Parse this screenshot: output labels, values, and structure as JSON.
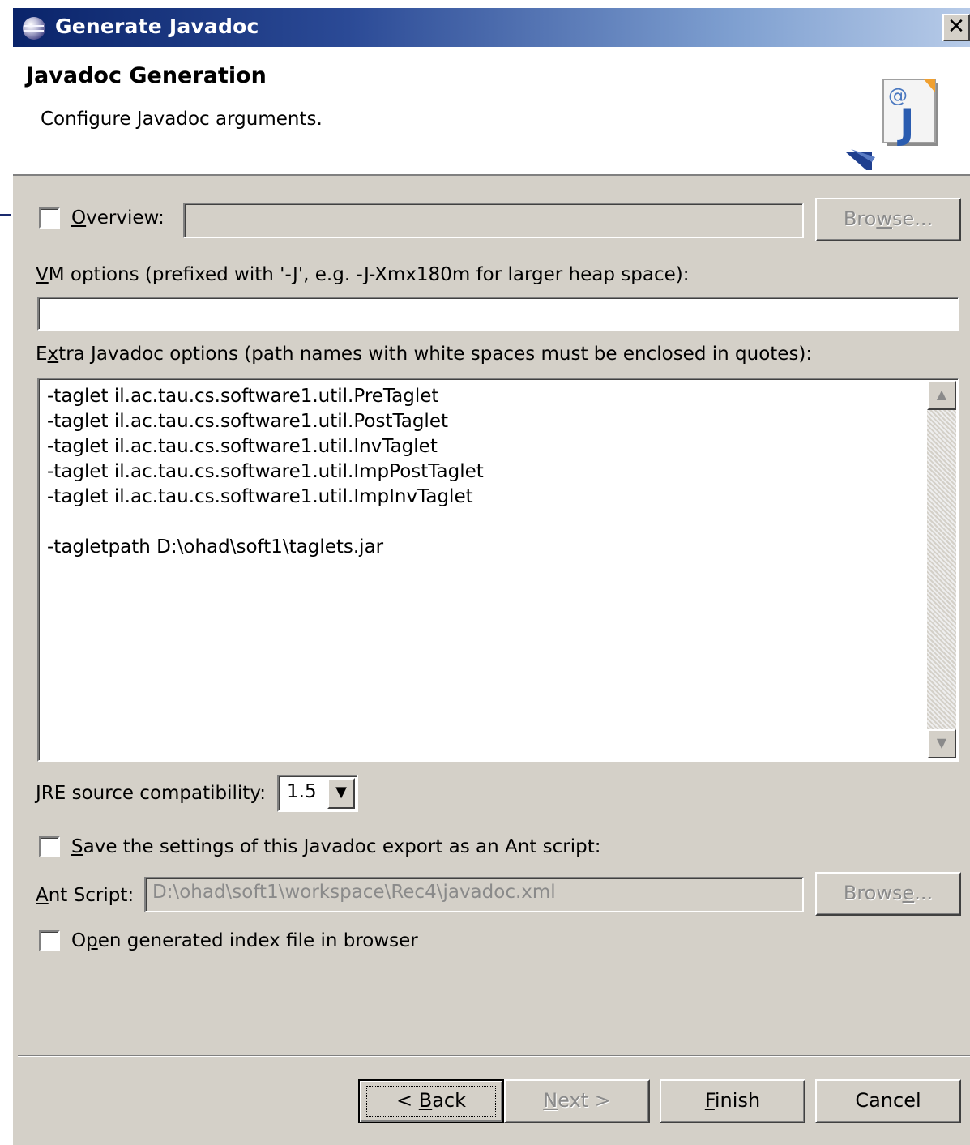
{
  "window": {
    "title": "Generate Javadoc",
    "close_glyph": "✕"
  },
  "header": {
    "title": "Javadoc Generation",
    "description": "Configure Javadoc arguments.",
    "icon": "javadoc-wizard-icon"
  },
  "overview": {
    "mnemonic": "O",
    "label_rest": "verview:",
    "checked": false,
    "value": "",
    "browse_pre": "Bro",
    "browse_mn": "w",
    "browse_post": "se..."
  },
  "vm_options": {
    "label_mn": "V",
    "label_rest": "M options (prefixed with '-J', e.g. -J-Xmx180m for larger heap space):",
    "value": ""
  },
  "extra_options": {
    "label_pre": "E",
    "label_mn": "x",
    "label_post": "tra Javadoc options (path names with white spaces must be enclosed in quotes):",
    "lines": [
      "-taglet il.ac.tau.cs.software1.util.PreTaglet",
      "-taglet il.ac.tau.cs.software1.util.PostTaglet",
      "-taglet il.ac.tau.cs.software1.util.InvTaglet",
      "-taglet il.ac.tau.cs.software1.util.ImpPostTaglet",
      "-taglet il.ac.tau.cs.software1.util.ImpInvTaglet",
      "",
      "-tagletpath D:\\ohad\\soft1\\taglets.jar"
    ],
    "scroll_up_glyph": "▲",
    "scroll_down_glyph": "▼"
  },
  "jre": {
    "label_mn": "J",
    "label_rest": "RE source compatibility:",
    "value": "1.5",
    "arrow_glyph": "▼"
  },
  "save_ant": {
    "mnemonic": "S",
    "label_rest": "ave the settings of this Javadoc export as an Ant script:",
    "checked": false
  },
  "ant_script": {
    "label_mn": "A",
    "label_rest": "nt Script:",
    "value": "D:\\ohad\\soft1\\workspace\\Rec4\\javadoc.xml",
    "browse_pre": "Brows",
    "browse_mn": "e",
    "browse_post": "..."
  },
  "open_index": {
    "label_pre": "O",
    "label_mn": "p",
    "label_post": "en generated index file in browser",
    "checked": false
  },
  "buttons": {
    "back_pre": "< ",
    "back_mn": "B",
    "back_post": "ack",
    "next_mn": "N",
    "next_post": "ext >",
    "finish_mn": "F",
    "finish_post": "inish",
    "cancel": "Cancel"
  }
}
